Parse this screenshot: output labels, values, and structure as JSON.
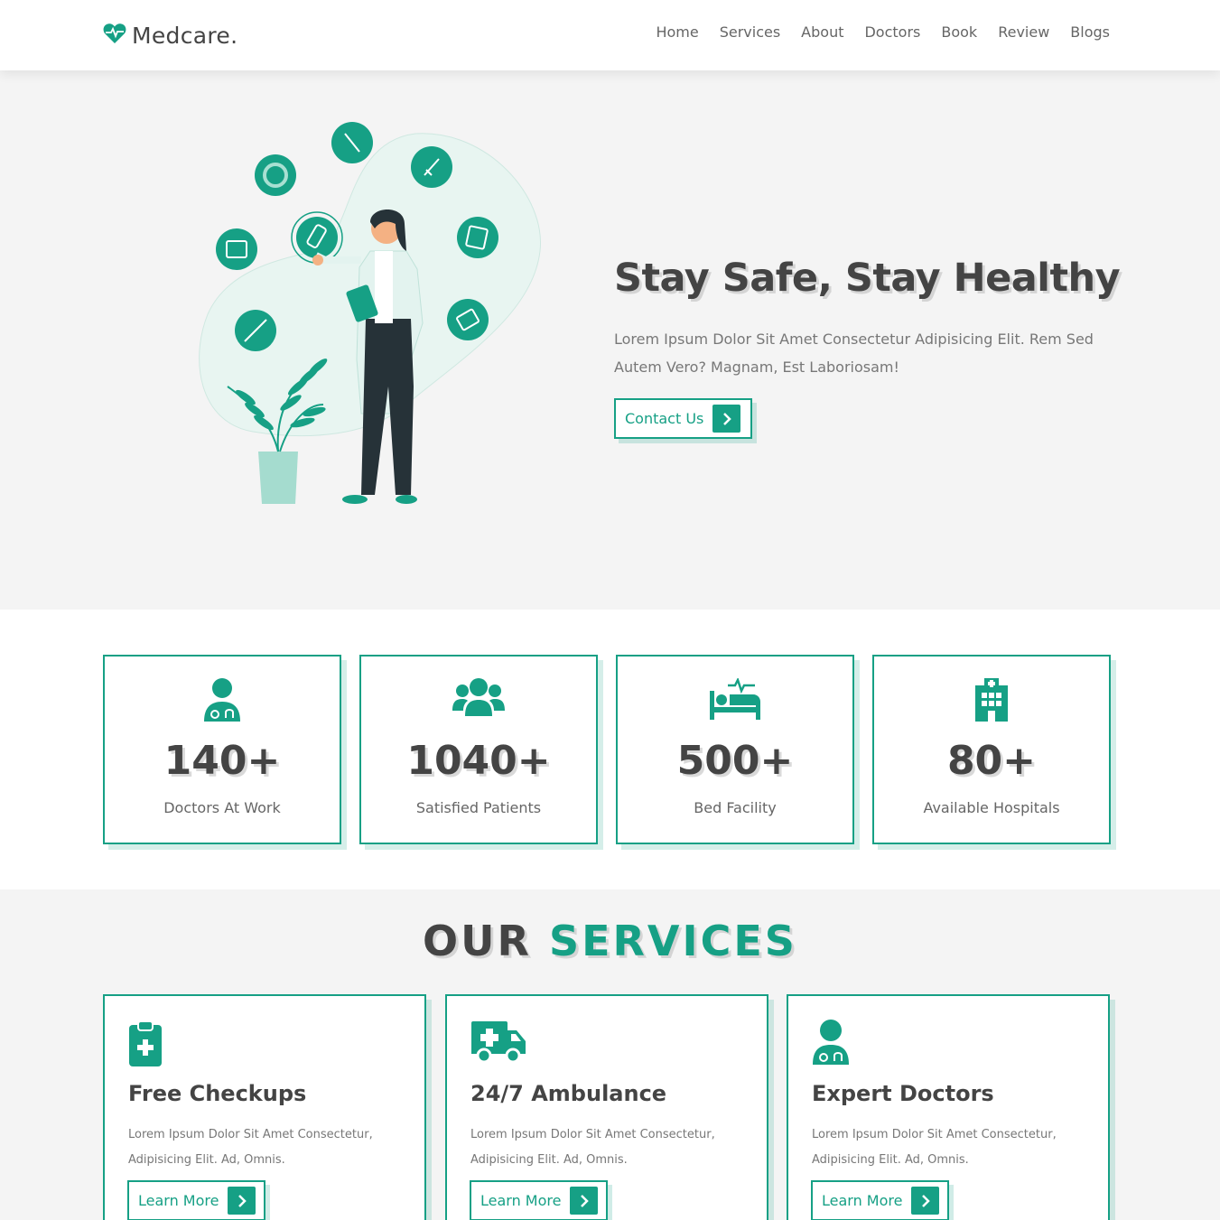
{
  "brand": {
    "name": "Medcare.",
    "icon": "heart-pulse-icon",
    "color": "#16a085"
  },
  "nav": {
    "items": [
      "Home",
      "Services",
      "About",
      "Doctors",
      "Book",
      "Review",
      "Blogs"
    ]
  },
  "hero": {
    "title": "Stay Safe, Stay Healthy",
    "text": "Lorem Ipsum Dolor Sit Amet Consectetur Adipisicing Elit. Rem Sed Autem Vero? Magnam, Est Laboriosam!",
    "button": "Contact Us"
  },
  "stats": [
    {
      "icon": "doctor-icon",
      "value": "140+",
      "label": "Doctors At Work"
    },
    {
      "icon": "users-icon",
      "value": "1040+",
      "label": "Satisfied Patients"
    },
    {
      "icon": "bed-icon",
      "value": "500+",
      "label": "Bed Facility"
    },
    {
      "icon": "hospital-icon",
      "value": "80+",
      "label": "Available Hospitals"
    }
  ],
  "services": {
    "heading_part1": "OUR",
    "heading_part2": "SERVICES",
    "items": [
      {
        "icon": "clipboard-medical-icon",
        "title": "Free Checkups",
        "text": "Lorem Ipsum Dolor Sit Amet Consectetur, Adipisicing Elit. Ad, Omnis.",
        "button": "Learn More"
      },
      {
        "icon": "ambulance-icon",
        "title": "24/7 Ambulance",
        "text": "Lorem Ipsum Dolor Sit Amet Consectetur, Adipisicing Elit. Ad, Omnis.",
        "button": "Learn More"
      },
      {
        "icon": "doctor-icon",
        "title": "Expert Doctors",
        "text": "Lorem Ipsum Dolor Sit Amet Consectetur, Adipisicing Elit. Ad, Omnis.",
        "button": "Learn More"
      }
    ]
  }
}
